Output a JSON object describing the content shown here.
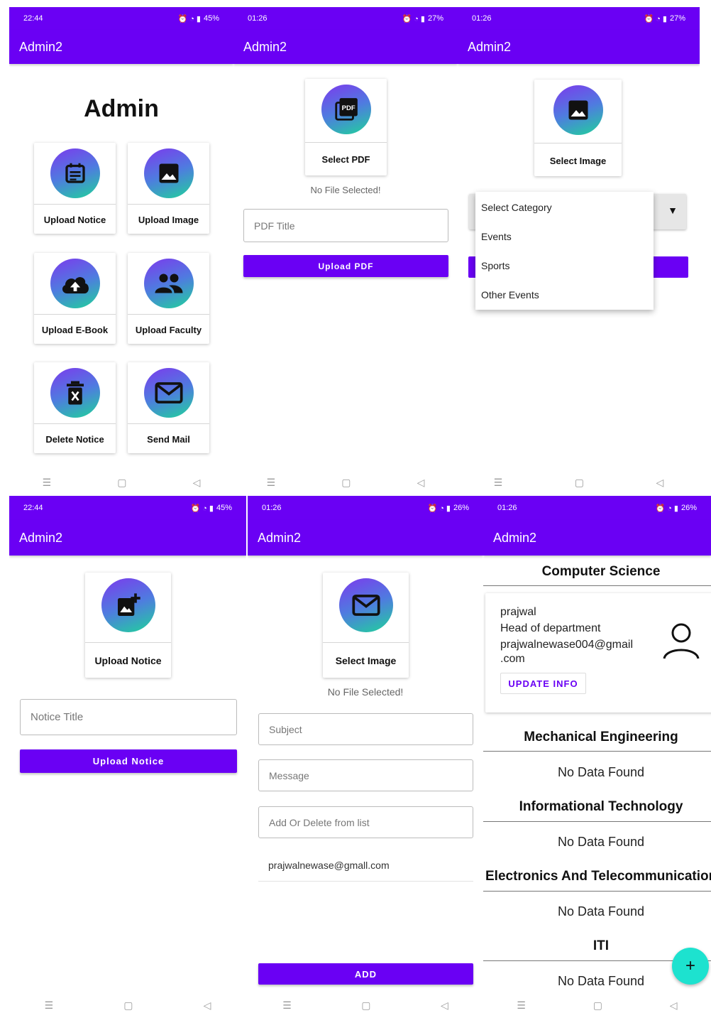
{
  "app": {
    "title": "Admin2",
    "accent": "#6a00f4"
  },
  "status_bars": {
    "s1": {
      "time": "22:44",
      "battery": "45%"
    },
    "s2": {
      "time": "01:26",
      "battery": "27%"
    },
    "s3": {
      "time": "01:26",
      "battery": "27%"
    },
    "s4": {
      "time": "22:44",
      "battery": "45%"
    },
    "s5": {
      "time": "01:26",
      "battery": "26%"
    },
    "s6": {
      "time": "01:26",
      "battery": "26%"
    }
  },
  "screen1": {
    "heading": "Admin",
    "tiles": [
      {
        "label": "Upload Notice",
        "icon": "calendar-icon"
      },
      {
        "label": "Upload Image",
        "icon": "image-icon"
      },
      {
        "label": "Upload E-Book",
        "icon": "cloud-upload-icon"
      },
      {
        "label": "Upload Faculty",
        "icon": "people-icon"
      },
      {
        "label": "Delete Notice",
        "icon": "delete-icon"
      },
      {
        "label": "Send Mail",
        "icon": "mail-icon"
      }
    ]
  },
  "screen2": {
    "card_label": "Select PDF",
    "status": "No File Selected!",
    "title_placeholder": "PDF Title",
    "upload_button": "Upload PDF"
  },
  "screen3": {
    "card_label": "Select Image",
    "dropdown_options": [
      "Select Category",
      "Events",
      "Sports",
      "Other Events"
    ]
  },
  "screen4": {
    "card_label": "Upload Notice",
    "title_placeholder": "Notice Title",
    "upload_button": "Upload Notice"
  },
  "screen5": {
    "card_label": "Select Image",
    "status": "No File Selected!",
    "subject_placeholder": "Subject",
    "message_placeholder": "Message",
    "list_placeholder": "Add Or Delete from list",
    "email": "prajwalnewase@gmall.com",
    "add_button": "ADD"
  },
  "screen6": {
    "sections": [
      {
        "name": "Computer Science"
      },
      {
        "name": "Mechanical Engineering",
        "empty": "No Data Found"
      },
      {
        "name": "Informational Technology",
        "empty": "No Data Found"
      },
      {
        "name": "Electronics And Telecommunication",
        "empty": "No Data Found"
      },
      {
        "name": "ITI",
        "empty": "No Data Found"
      }
    ],
    "faculty": {
      "name": "prajwal",
      "post": "Head of department",
      "email_line1": "prajwalnewase004@gmail",
      "email_line2": ".com",
      "update_button": "UPDATE INFO"
    },
    "fab": "+"
  }
}
